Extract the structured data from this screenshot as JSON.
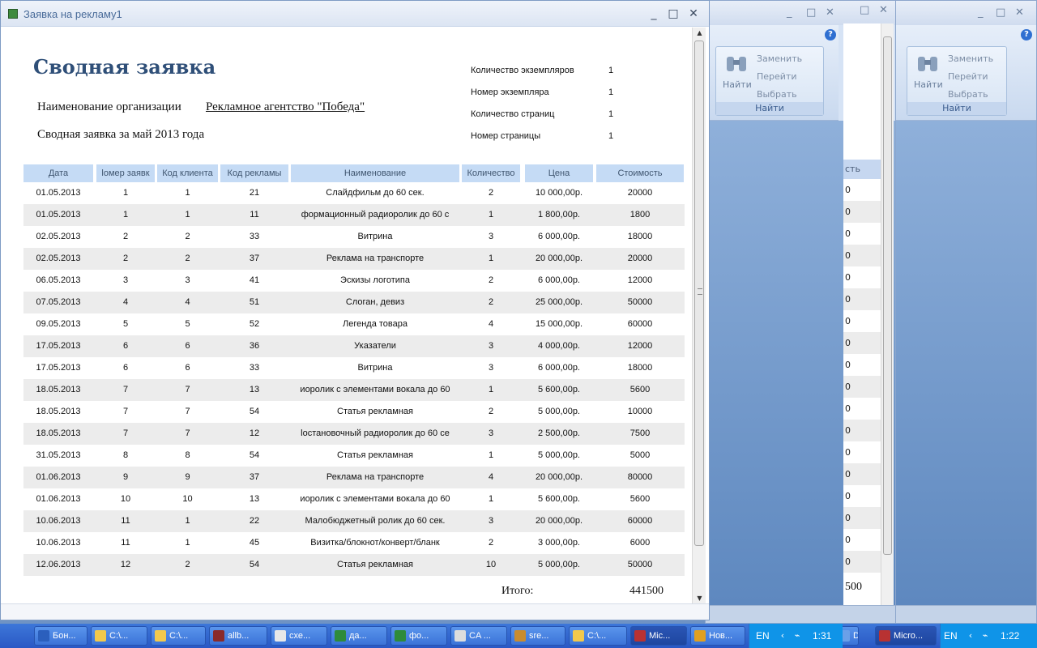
{
  "main_window": {
    "title": "Заявка на рекламу1",
    "controls": {
      "minimize": "_",
      "maximize": "□",
      "close": "✕"
    }
  },
  "report": {
    "title": "Сводная заявка",
    "org_label": "Наименование организации",
    "org_value": "Рекламное агентство \"Победа\"",
    "period": "Сводная заявка за май 2013 года",
    "meta": [
      {
        "label": "Количество экземпляров",
        "value": "1"
      },
      {
        "label": "Номер экземпляра",
        "value": "1"
      },
      {
        "label": "Количество страниц",
        "value": "1"
      },
      {
        "label": "Номер страницы",
        "value": "1"
      }
    ],
    "columns": [
      "Дата",
      "Номер заявки",
      "Код клиента",
      "Код рекламы",
      "Наименование",
      "Количество",
      "Цена",
      "Стоимость"
    ],
    "columns_visible": [
      "Дата",
      "lомер заявк",
      "Код клиента",
      "Код рекламы",
      "Наименование",
      "Количество",
      "Цена",
      "Стоимость"
    ],
    "rows": [
      [
        "01.05.2013",
        "1",
        "1",
        "21",
        "Слайдфильм до 60 сек.",
        "2",
        "10 000,00р.",
        "20000"
      ],
      [
        "01.05.2013",
        "1",
        "1",
        "11",
        "формационный радиоролик до 60 с",
        "1",
        "1 800,00р.",
        "1800"
      ],
      [
        "02.05.2013",
        "2",
        "2",
        "33",
        "Витрина",
        "3",
        "6 000,00р.",
        "18000"
      ],
      [
        "02.05.2013",
        "2",
        "2",
        "37",
        "Реклама на транспорте",
        "1",
        "20 000,00р.",
        "20000"
      ],
      [
        "06.05.2013",
        "3",
        "3",
        "41",
        "Эскизы логотипа",
        "2",
        "6 000,00р.",
        "12000"
      ],
      [
        "07.05.2013",
        "4",
        "4",
        "51",
        "Слоган, девиз",
        "2",
        "25 000,00р.",
        "50000"
      ],
      [
        "09.05.2013",
        "5",
        "5",
        "52",
        "Легенда товара",
        "4",
        "15 000,00р.",
        "60000"
      ],
      [
        "17.05.2013",
        "6",
        "6",
        "36",
        "Указатели",
        "3",
        "4 000,00р.",
        "12000"
      ],
      [
        "17.05.2013",
        "6",
        "6",
        "33",
        "Витрина",
        "3",
        "6 000,00р.",
        "18000"
      ],
      [
        "18.05.2013",
        "7",
        "7",
        "13",
        "иоролик с элементами вокала до 60",
        "1",
        "5 600,00р.",
        "5600"
      ],
      [
        "18.05.2013",
        "7",
        "7",
        "54",
        "Статья рекламная",
        "2",
        "5 000,00р.",
        "10000"
      ],
      [
        "18.05.2013",
        "7",
        "7",
        "12",
        "lостановочный радиоролик до 60 се",
        "3",
        "2 500,00р.",
        "7500"
      ],
      [
        "31.05.2013",
        "8",
        "8",
        "54",
        "Статья рекламная",
        "1",
        "5 000,00р.",
        "5000"
      ],
      [
        "01.06.2013",
        "9",
        "9",
        "37",
        "Реклама на транспорте",
        "4",
        "20 000,00р.",
        "80000"
      ],
      [
        "01.06.2013",
        "10",
        "10",
        "13",
        "иоролик с элементами вокала до 60",
        "1",
        "5 600,00р.",
        "5600"
      ],
      [
        "10.06.2013",
        "11",
        "1",
        "22",
        "Малобюджетный ролик до 60 сек.",
        "3",
        "20 000,00р.",
        "60000"
      ],
      [
        "10.06.2013",
        "11",
        "1",
        "45",
        "Визитка/блокнот/конверт/бланк",
        "2",
        "3 000,00р.",
        "6000"
      ],
      [
        "12.06.2013",
        "12",
        "2",
        "54",
        "Статья рекламная",
        "10",
        "5 000,00р.",
        "50000"
      ]
    ],
    "total_label": "Итого:",
    "total_value": "441500"
  },
  "bg_window_1": {
    "controls": {
      "minimize": "_",
      "maximize": "□",
      "close": "✕"
    },
    "find_group": {
      "find_button": "Найти",
      "replace": "Заменить",
      "goto": "Перейти",
      "select": "Выбрать",
      "group_label": "Найти"
    },
    "table_header_fragment": "сть",
    "cell_fragments": [
      "0",
      "0",
      "0",
      "0",
      "0",
      "0",
      "0",
      "0",
      "0",
      "0",
      "0",
      "0",
      "0",
      "0",
      "0",
      "0",
      "0",
      "0"
    ],
    "total_fragment": "500"
  },
  "bg_window_2": {
    "controls": {
      "minimize": "_",
      "maximize": "□",
      "close": "✕"
    },
    "find_group": {
      "find_button": "Найти",
      "replace": "Заменить",
      "goto": "Перейти",
      "select": "Выбрать",
      "group_label": "Найти"
    }
  },
  "taskbar": {
    "buttons": [
      {
        "label": "Бон...",
        "icon": "word-doc-icon",
        "color": "#2b5fbd"
      },
      {
        "label": "C:\\...",
        "icon": "folder-icon",
        "color": "#f2c94c"
      },
      {
        "label": "C:\\...",
        "icon": "folder-icon",
        "color": "#f2c94c"
      },
      {
        "label": "allb...",
        "icon": "archive-icon",
        "color": "#8a2a2a"
      },
      {
        "label": "схе...",
        "icon": "doc-icon",
        "color": "#e8e8e8"
      },
      {
        "label": "да...",
        "icon": "excel-icon",
        "color": "#2e8b3a"
      },
      {
        "label": "фо...",
        "icon": "excel-icon",
        "color": "#2e8b3a"
      },
      {
        "label": "CA ...",
        "icon": "network-icon",
        "color": "#dddddd"
      },
      {
        "label": "sre...",
        "icon": "app-icon",
        "color": "#c98c2e"
      },
      {
        "label": "C:\\...",
        "icon": "folder-icon",
        "color": "#f2c94c"
      },
      {
        "label": "Mic...",
        "icon": "access-icon",
        "color": "#b83232"
      },
      {
        "label": "Нов...",
        "icon": "chrome-icon",
        "color": "#e0a020"
      },
      {
        "label": "D...",
        "icon": "app-icon",
        "color": "#6aa0e8"
      },
      {
        "label": "Micro...",
        "icon": "access-icon",
        "color": "#b83232"
      }
    ],
    "tray1": {
      "lang": "EN",
      "time": "1:31"
    },
    "tray2": {
      "lang": "EN",
      "time": "1:22"
    }
  }
}
